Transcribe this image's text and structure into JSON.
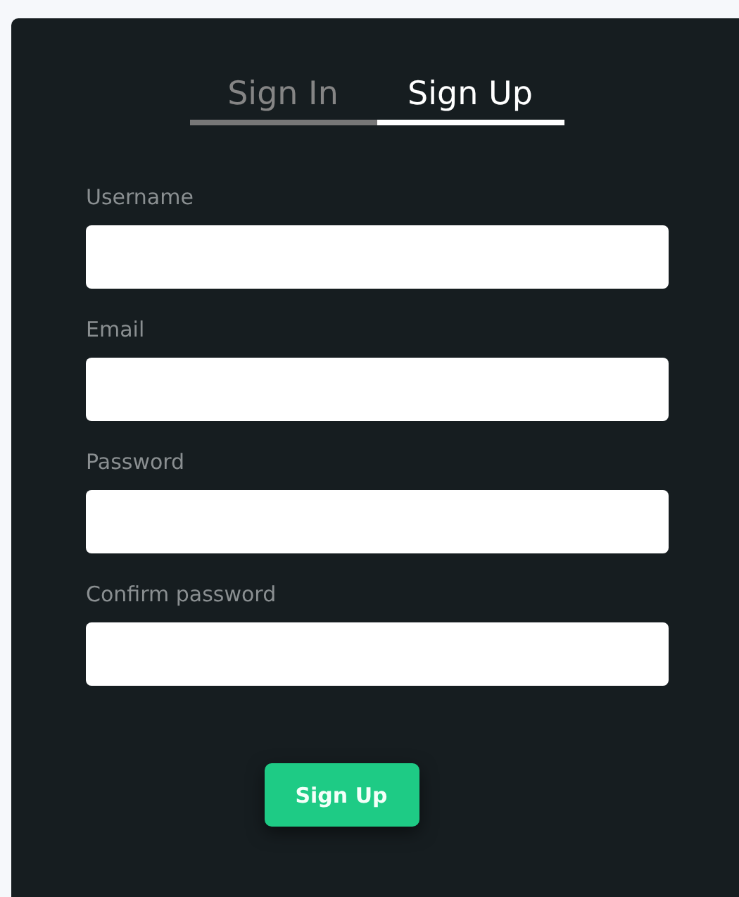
{
  "tabs": [
    {
      "label": "Sign In",
      "selected": false
    },
    {
      "label": "Sign Up",
      "selected": true
    }
  ],
  "fields": [
    {
      "label": "Username"
    },
    {
      "label": "Email"
    },
    {
      "label": "Password"
    },
    {
      "label": "Confirm password"
    }
  ],
  "submit": {
    "label": "Sign Up"
  }
}
